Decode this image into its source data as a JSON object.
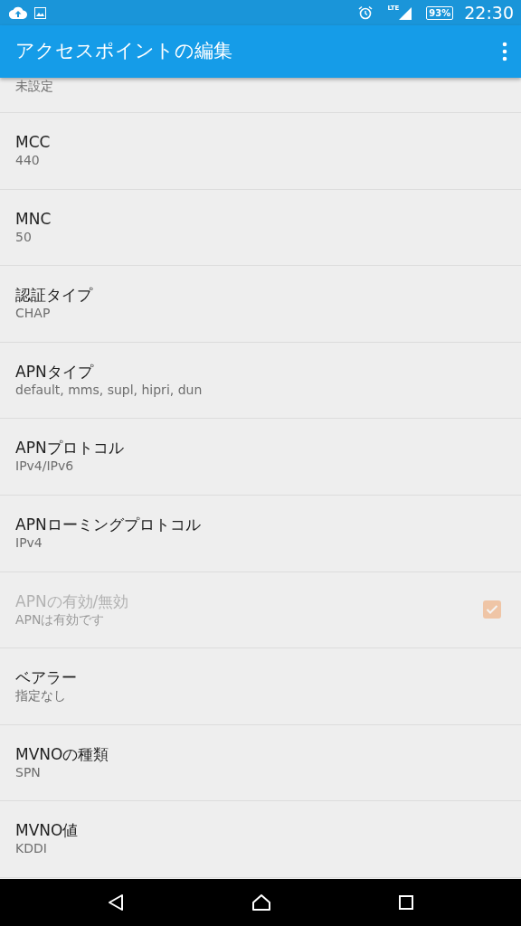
{
  "status_bar": {
    "network": "LTE",
    "battery": "93%",
    "time": "22:30"
  },
  "app_bar": {
    "title": "アクセスポイントの編集"
  },
  "partial_item": {
    "summary": "未設定"
  },
  "preferences": [
    {
      "kind": "text",
      "title": "MCC",
      "summary": "440",
      "disabled": false
    },
    {
      "kind": "text",
      "title": "MNC",
      "summary": "50",
      "disabled": false
    },
    {
      "kind": "text",
      "title": "認証タイプ",
      "summary": "CHAP",
      "disabled": false
    },
    {
      "kind": "text",
      "title": "APNタイプ",
      "summary": "default, mms, supl, hipri, dun",
      "disabled": false
    },
    {
      "kind": "text",
      "title": "APNプロトコル",
      "summary": "IPv4/IPv6",
      "disabled": false
    },
    {
      "kind": "text",
      "title": "APNローミングプロトコル",
      "summary": "IPv4",
      "disabled": false
    },
    {
      "kind": "checkbox",
      "title": "APNの有効/無効",
      "summary": "APNは有効です",
      "disabled": true,
      "checked": true
    },
    {
      "kind": "text",
      "title": "ベアラー",
      "summary": "指定なし",
      "disabled": false
    },
    {
      "kind": "text",
      "title": "MVNOの種類",
      "summary": "SPN",
      "disabled": false
    },
    {
      "kind": "text",
      "title": "MVNO値",
      "summary": "KDDI",
      "disabled": false
    }
  ]
}
